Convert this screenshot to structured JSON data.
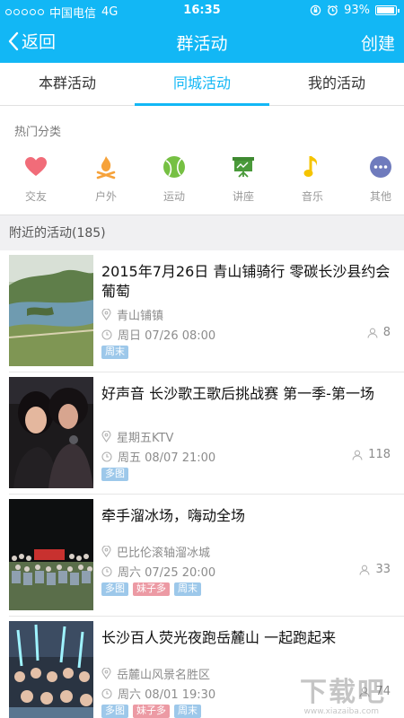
{
  "status_bar": {
    "carrier": "中国电信",
    "network": "4G",
    "time": "16:35",
    "battery": "93%",
    "battery_level": 0.93
  },
  "nav": {
    "back_label": "返回",
    "title": "群活动",
    "create_label": "创建"
  },
  "tabs": [
    {
      "label": "本群活动"
    },
    {
      "label": "同城活动"
    },
    {
      "label": "我的活动"
    }
  ],
  "categories": {
    "heading": "热门分类",
    "items": [
      {
        "label": "交友",
        "icon": "heart-icon",
        "color": "#f16c79"
      },
      {
        "label": "户外",
        "icon": "campfire-icon",
        "color": "#f6a23a"
      },
      {
        "label": "运动",
        "icon": "ball-icon",
        "color": "#76c043"
      },
      {
        "label": "讲座",
        "icon": "presentation-board-icon",
        "color": "#4a9a3a"
      },
      {
        "label": "音乐",
        "icon": "music-note-icon",
        "color": "#f5c400"
      },
      {
        "label": "其他",
        "icon": "more-icon",
        "color": "#6f7bbd"
      }
    ]
  },
  "section": {
    "title": "附近的活动(185)"
  },
  "activities": [
    {
      "title": "2015年7月26日 青山铺骑行  零碳长沙县约会葡萄",
      "location": "青山铺镇",
      "time": "周日 07/26 08:00",
      "count": "8",
      "tags": [
        {
          "label": "周末",
          "color": "blue"
        }
      ]
    },
    {
      "title": "好声音 长沙歌王歌后挑战赛  第一季-第一场",
      "location": "星期五KTV",
      "time": "周五 08/07 21:00",
      "count": "118",
      "tags": [
        {
          "label": "多图",
          "color": "blue"
        }
      ]
    },
    {
      "title": "牵手溜冰场，嗨动全场",
      "location": "巴比伦滚轴溜冰城",
      "time": "周六 07/25 20:00",
      "count": "33",
      "tags": [
        {
          "label": "多图",
          "color": "blue"
        },
        {
          "label": "妹子多",
          "color": "pink"
        },
        {
          "label": "周末",
          "color": "blue"
        }
      ]
    },
    {
      "title": "长沙百人荧光夜跑岳麓山 一起跑起来",
      "location": "岳麓山风景名胜区",
      "time": "周六 08/01 19:30",
      "count": "74",
      "tags": [
        {
          "label": "多图",
          "color": "blue"
        },
        {
          "label": "妹子多",
          "color": "pink"
        },
        {
          "label": "周末",
          "color": "blue"
        }
      ]
    }
  ],
  "watermark": {
    "text": "下载吧",
    "sub": "www.xiazaiba.com"
  }
}
